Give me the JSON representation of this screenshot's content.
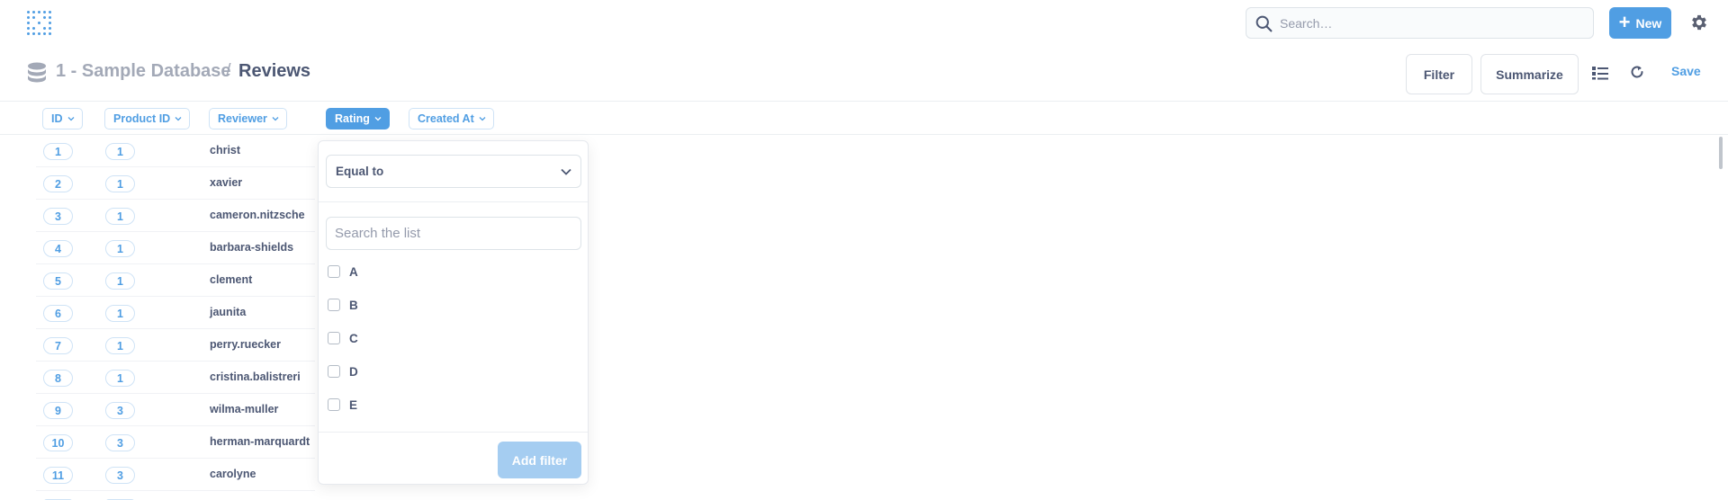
{
  "app": {
    "search_placeholder": "Search…",
    "new_label": "New",
    "accent_color": "#509ee3"
  },
  "header": {
    "database": "1 - Sample Database",
    "separator": "/",
    "table": "Reviews",
    "filter_label": "Filter",
    "summarize_label": "Summarize",
    "save_label": "Save"
  },
  "columns": [
    {
      "label": "ID",
      "active": false
    },
    {
      "label": "Product ID",
      "active": false
    },
    {
      "label": "Reviewer",
      "active": false
    },
    {
      "label": "Rating",
      "active": true
    },
    {
      "label": "Created At",
      "active": false
    }
  ],
  "rows": [
    {
      "id": "1",
      "product_id": "1",
      "reviewer": "christ"
    },
    {
      "id": "2",
      "product_id": "1",
      "reviewer": "xavier"
    },
    {
      "id": "3",
      "product_id": "1",
      "reviewer": "cameron.nitzsche"
    },
    {
      "id": "4",
      "product_id": "1",
      "reviewer": "barbara-shields"
    },
    {
      "id": "5",
      "product_id": "1",
      "reviewer": "clement"
    },
    {
      "id": "6",
      "product_id": "1",
      "reviewer": "jaunita"
    },
    {
      "id": "7",
      "product_id": "1",
      "reviewer": "perry.ruecker"
    },
    {
      "id": "8",
      "product_id": "1",
      "reviewer": "cristina.balistreri"
    },
    {
      "id": "9",
      "product_id": "3",
      "reviewer": "wilma-muller"
    },
    {
      "id": "10",
      "product_id": "3",
      "reviewer": "herman-marquardt"
    },
    {
      "id": "11",
      "product_id": "3",
      "reviewer": "carolyne"
    }
  ],
  "filter_popover": {
    "operator": "Equal to",
    "search_placeholder": "Search the list",
    "options": [
      "A",
      "B",
      "C",
      "D",
      "E"
    ],
    "add_label": "Add filter"
  }
}
